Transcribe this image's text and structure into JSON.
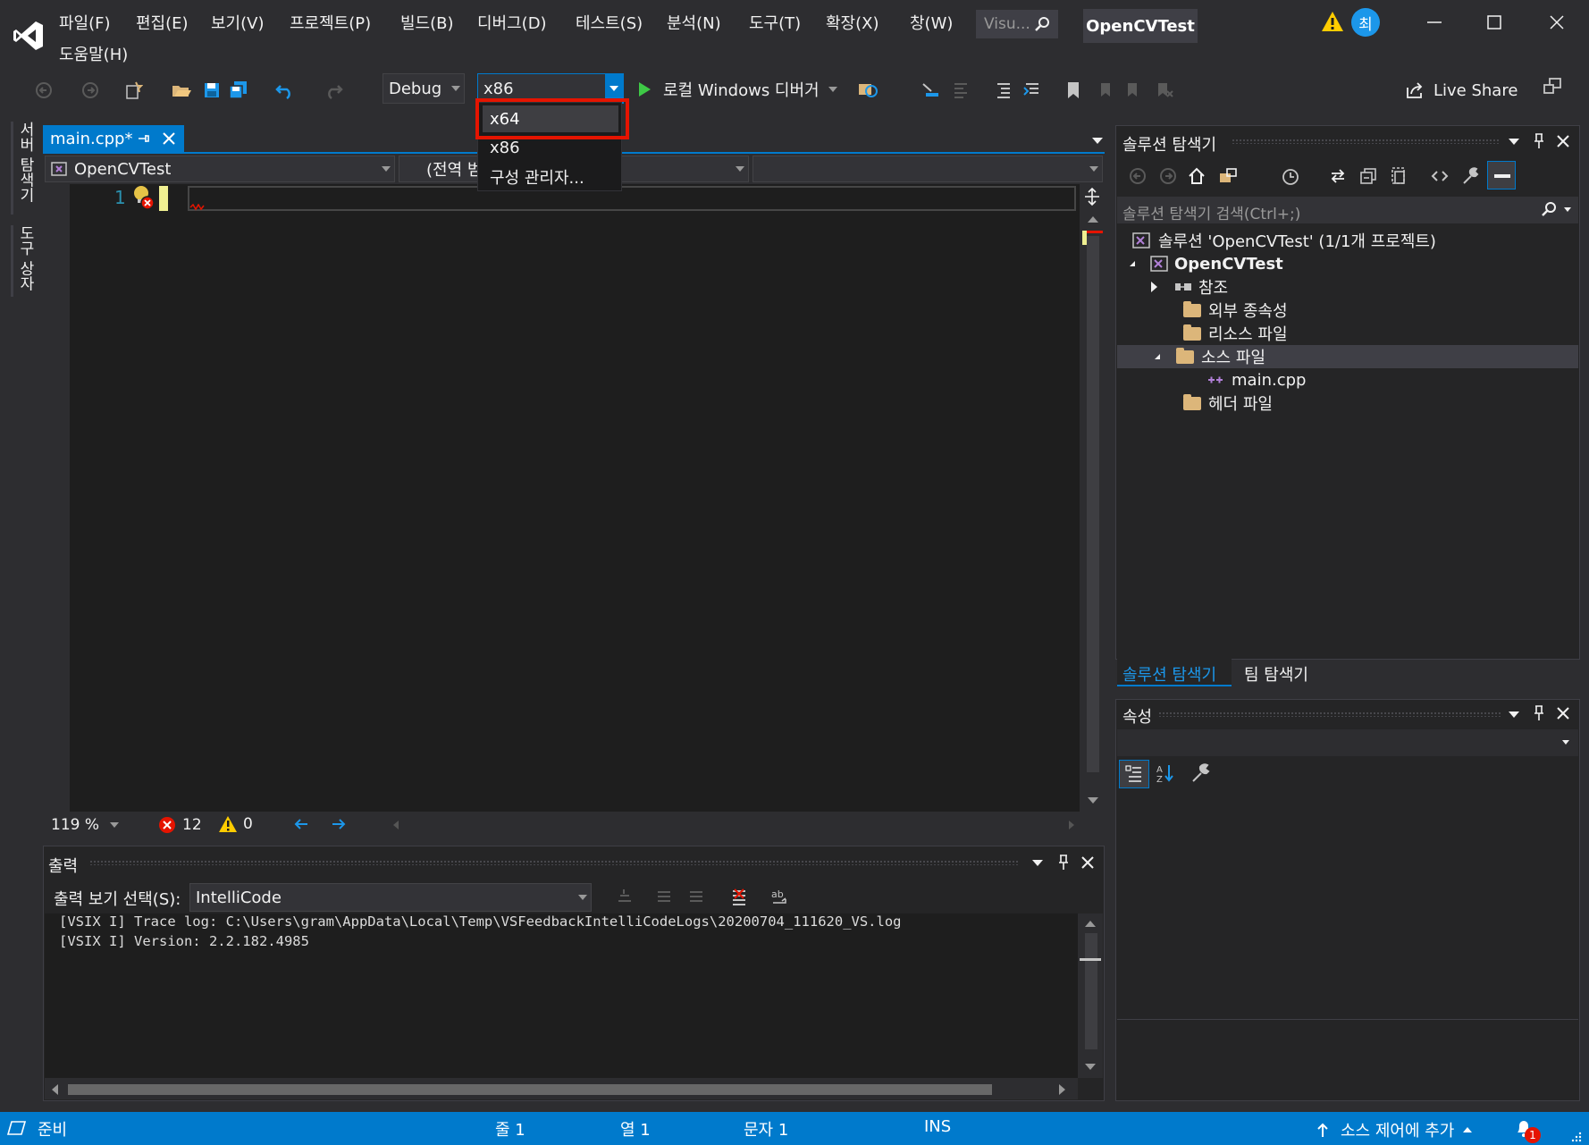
{
  "app": {
    "project_title": "OpenCVTest",
    "search_placeholder": "Visu...",
    "account_initial": "최"
  },
  "menu": {
    "items": [
      "파일(F)",
      "편집(E)",
      "보기(V)",
      "프로젝트(P)",
      "빌드(B)",
      "디버그(D)",
      "테스트(S)",
      "분석(N)",
      "도구(T)",
      "확장(X)",
      "창(W)"
    ],
    "help": "도움말(H)"
  },
  "toolbar": {
    "config": "Debug",
    "platform": "x86",
    "run_label": "로컬 Windows 디버거",
    "live_share": "Live Share"
  },
  "platform_dropdown": {
    "options": [
      "x64",
      "x86",
      "구성 관리자..."
    ],
    "highlighted": "x64"
  },
  "left_rail": {
    "server_explorer": "서버 탐색기",
    "toolbox": "도구 상자"
  },
  "editor": {
    "tab_label": "main.cpp*",
    "nav_project": "OpenCVTest",
    "nav_scope": "(전역 범위)",
    "line_number": "1",
    "zoom": "119 %",
    "error_count": "12",
    "warning_count": "0"
  },
  "output": {
    "title": "출력",
    "source_label": "출력 보기 선택(S):",
    "source_value": "IntelliCode",
    "lines": [
      "[VSIX I] Trace log: C:\\Users\\gram\\AppData\\Local\\Temp\\VSFeedbackIntelliCodeLogs\\20200704_111620_VS.log",
      "[VSIX I] Version: 2.2.182.4985"
    ]
  },
  "solution_explorer": {
    "title": "솔루션 탐색기",
    "search_placeholder": "솔루션 탐색기 검색(Ctrl+;)",
    "solution_label": "솔루션 'OpenCVTest' (1/1개 프로젝트)",
    "project": "OpenCVTest",
    "references": "참조",
    "external_deps": "외부 종속성",
    "resource_files": "리소스 파일",
    "source_files": "소스 파일",
    "main_cpp": "main.cpp",
    "header_files": "헤더 파일",
    "tab_solution": "솔루션 탐색기",
    "tab_team": "팀 탐색기"
  },
  "properties": {
    "title": "속성"
  },
  "status_bar": {
    "ready": "준비",
    "line": "줄 1",
    "col": "열 1",
    "char": "문자 1",
    "ins": "INS",
    "source_control": "소스 제어에 추가",
    "notification_count": "1"
  },
  "colors": {
    "accent_blue": "#007acc",
    "editor_bg": "#1e1e1e",
    "chrome_bg": "#2d2d30",
    "highlight_red": "#e51400",
    "error_red": "#e51400",
    "warning_yellow": "#ffcc00"
  }
}
